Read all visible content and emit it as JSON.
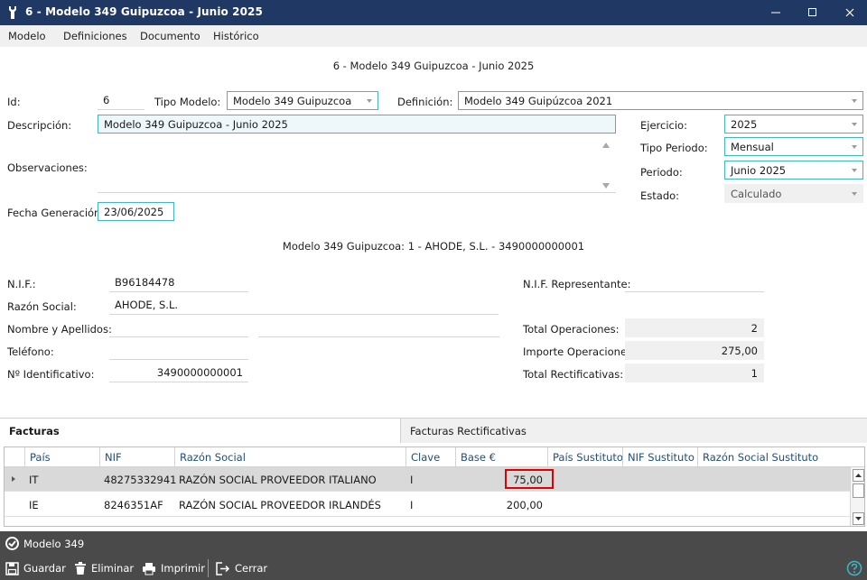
{
  "window": {
    "title": "6 - Modelo 349 Guipuzcoa - Junio 2025"
  },
  "menu": [
    "Modelo",
    "Definiciones",
    "Documento",
    "Histórico"
  ],
  "form": {
    "heading": "6 - Modelo 349 Guipuzcoa - Junio 2025",
    "id": {
      "label": "Id:",
      "value": "6"
    },
    "tipo_modelo": {
      "label": "Tipo Modelo:",
      "value": "Modelo 349 Guipuzcoa"
    },
    "definicion": {
      "label": "Definición:",
      "value": "Modelo 349 Guipúzcoa 2021"
    },
    "descripcion": {
      "label": "Descripción:",
      "value": "Modelo 349 Guipuzcoa - Junio 2025"
    },
    "observaciones": {
      "label": "Observaciones:",
      "value": ""
    },
    "fecha_generacion": {
      "label": "Fecha Generación:",
      "value": "23/06/2025"
    },
    "ejercicio": {
      "label": "Ejercicio:",
      "value": "2025"
    },
    "tipo_periodo": {
      "label": "Tipo Periodo:",
      "value": "Mensual"
    },
    "periodo": {
      "label": "Periodo:",
      "value": "Junio 2025"
    },
    "estado": {
      "label": "Estado:",
      "value": "Calculado"
    }
  },
  "declarante": {
    "heading": "Modelo 349 Guipuzcoa: 1 - AHODE, S.L. - 3490000000001",
    "nif": {
      "label": "N.I.F.:",
      "value": "B96184478"
    },
    "razon_social": {
      "label": "Razón Social:",
      "value": "AHODE, S.L."
    },
    "nombre_apellidos": {
      "label": "Nombre y Apellidos:",
      "value": ""
    },
    "telefono": {
      "label": "Teléfono:",
      "value": ""
    },
    "num_identificativo": {
      "label": "Nº Identificativo:",
      "value": "3490000000001"
    },
    "nif_representante": {
      "label": "N.I.F. Representante:",
      "value": ""
    },
    "total_operaciones": {
      "label": "Total Operaciones:",
      "value": "2"
    },
    "importe_operaciones": {
      "label": "Importe Operaciones:",
      "value": "275,00"
    },
    "total_rectificativas": {
      "label": "Total Rectificativas:",
      "value": "1"
    }
  },
  "tabs": [
    {
      "label": "Facturas",
      "active": true
    },
    {
      "label": "Facturas Rectificativas",
      "active": false
    }
  ],
  "grid": {
    "columns": [
      "País",
      "NIF",
      "Razón Social",
      "Clave",
      "Base €",
      "País Sustituto",
      "NIF Sustituto",
      "Razón Social Sustituto"
    ],
    "rows": [
      {
        "pais": "IT",
        "nif": "48275332941",
        "razon": "RAZÓN SOCIAL PROVEEDOR ITALIANO",
        "clave": "I",
        "base": "75,00",
        "selected": true
      },
      {
        "pais": "IE",
        "nif": "8246351AF",
        "razon": "RAZÓN SOCIAL PROVEEDOR IRLANDÉS",
        "clave": "I",
        "base": "200,00",
        "selected": false
      }
    ]
  },
  "status": {
    "label": "Modelo 349"
  },
  "toolbar": {
    "guardar": "Guardar",
    "eliminar": "Eliminar",
    "imprimir": "Imprimir",
    "cerrar": "Cerrar"
  },
  "colors": {
    "titlebar": "#1f3864",
    "accent": "#3bb8c9",
    "highlight": "#e00000",
    "bottom_bar": "#4a4a4a"
  }
}
